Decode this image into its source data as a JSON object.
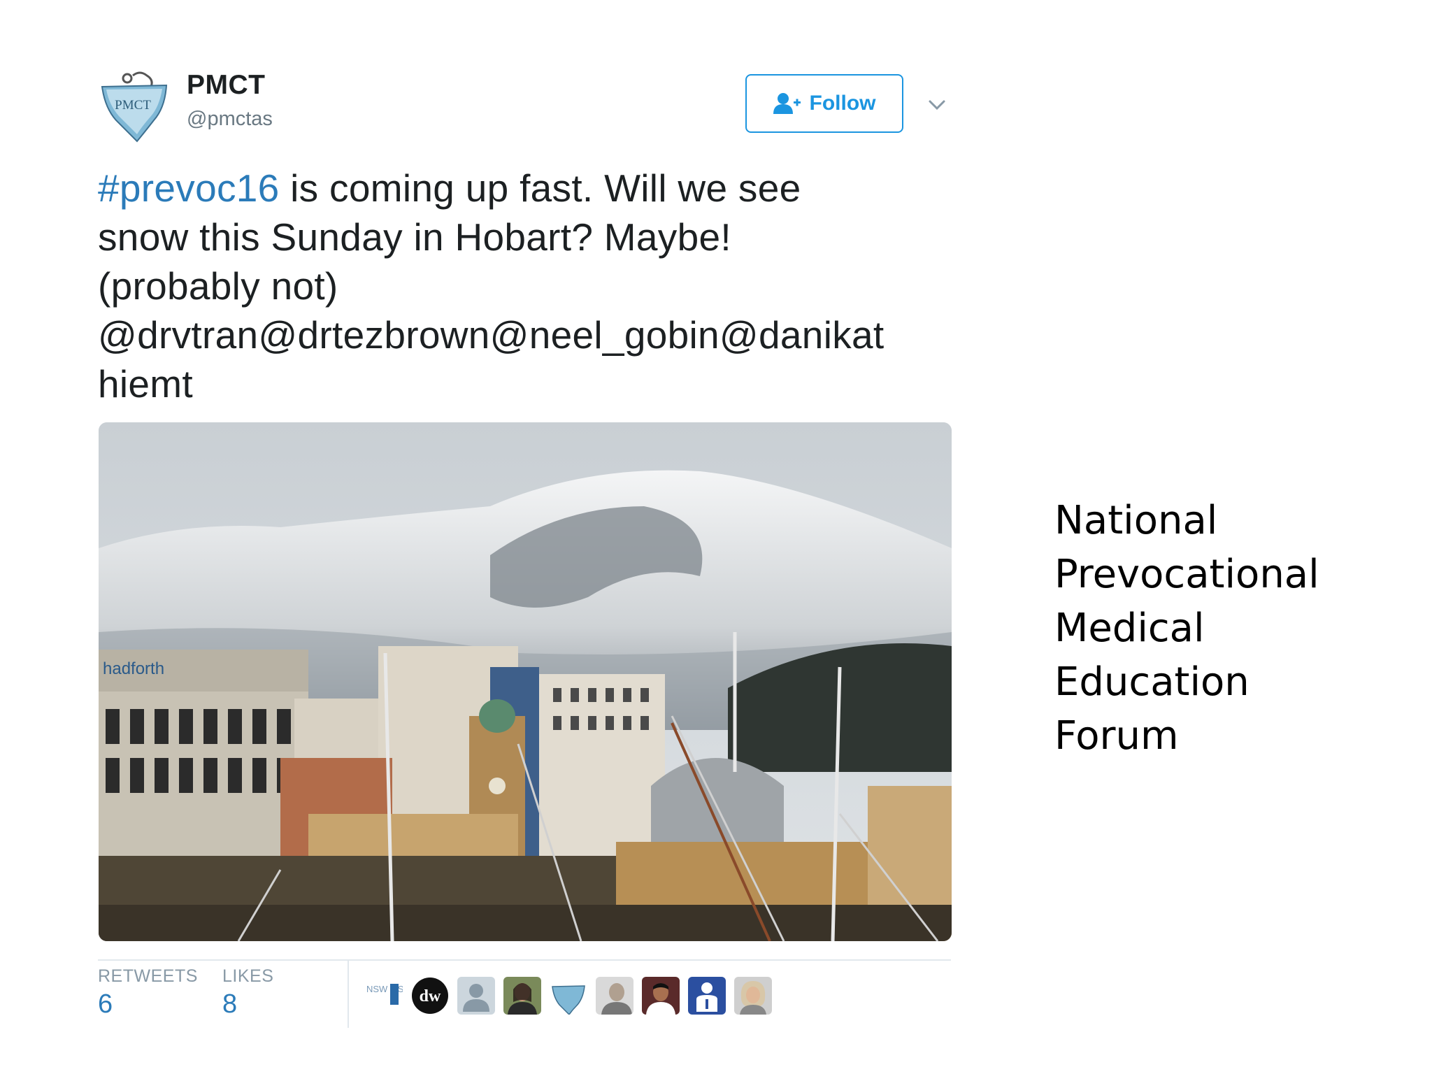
{
  "tweet": {
    "display_name": "PMCT",
    "handle": "@pmctas",
    "avatar_text": "PMCT",
    "follow_label": "Follow",
    "text_lines": [
      {
        "hashtag": "#prevoc16",
        "rest": " is coming up fast. Will we see"
      },
      {
        "hashtag": "",
        "rest": "snow this Sunday in Hobart? Maybe!"
      },
      {
        "hashtag": "",
        "rest": "(probably not)"
      },
      {
        "hashtag": "",
        "rest": "@drvtran@drtezbrown@neel_gobin@danikat"
      },
      {
        "hashtag": "",
        "rest": "hiemt"
      }
    ],
    "photo_sign_text": "hadforth",
    "retweets_label": "RETWEETS",
    "retweets_count": "6",
    "likes_label": "LIKES",
    "likes_count": "8",
    "likers": [
      {
        "name": "nsw-msc-avatar",
        "text": "NSW MSC"
      },
      {
        "name": "dw-avatar",
        "text": "dw"
      },
      {
        "name": "default-user-avatar",
        "text": ""
      },
      {
        "name": "user-photo-avatar-1",
        "text": ""
      },
      {
        "name": "pmct-avatar-small",
        "text": ""
      },
      {
        "name": "user-photo-avatar-2",
        "text": ""
      },
      {
        "name": "user-photo-avatar-3",
        "text": ""
      },
      {
        "name": "doctor-logo-avatar",
        "text": ""
      },
      {
        "name": "user-photo-avatar-4",
        "text": ""
      }
    ],
    "colors": {
      "link": "#2b7bb9",
      "follow": "#1b95e0",
      "text": "#1c2022",
      "muted": "#697882"
    }
  },
  "side": {
    "title_lines": [
      "National",
      "Prevocational",
      "Medical",
      "Education",
      "Forum"
    ]
  }
}
